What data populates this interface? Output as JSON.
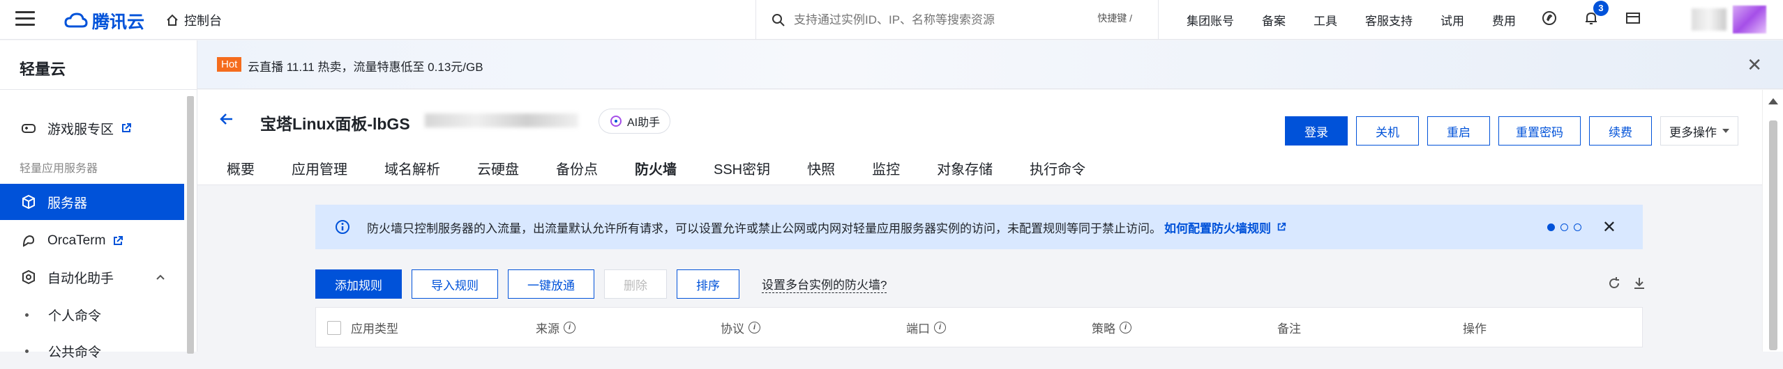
{
  "topbar": {
    "brand": "腾讯云",
    "console": "控制台",
    "search_placeholder": "支持通过实例ID、IP、名称等搜索资源",
    "shortcut": "快捷键 /",
    "links": [
      "集团账号",
      "备案",
      "工具",
      "客服支持",
      "试用",
      "费用"
    ],
    "notification_count": "3"
  },
  "banner": {
    "hot": "Hot",
    "text": "云直播 11.11 热卖，流量特惠低至 0.13元/GB"
  },
  "sidebar": {
    "title": "轻量云",
    "game_zone": "游戏服专区",
    "section": "轻量应用服务器",
    "servers": "服务器",
    "orcaterm": "OrcaTerm",
    "automation": "自动化助手",
    "personal_cmd": "个人命令",
    "public_cmd": "公共命令"
  },
  "instance": {
    "title": "宝塔Linux面板-lbGS",
    "ai": "AI助手"
  },
  "actions": [
    "登录",
    "关机",
    "重启",
    "重置密码",
    "续费"
  ],
  "more_actions": "更多操作",
  "tabs": [
    "概要",
    "应用管理",
    "域名解析",
    "云硬盘",
    "备份点",
    "防火墙",
    "SSH密钥",
    "快照",
    "监控",
    "对象存储",
    "执行命令"
  ],
  "active_tab": "防火墙",
  "info": {
    "text": "防火墙只控制服务器的入流量，出流量默认允许所有请求，可以设置允许或禁止公网或内网对轻量应用服务器实例的访问，未配置规则等同于禁止访问。",
    "link": "如何配置防火墙规则"
  },
  "toolbar": {
    "add": "添加规则",
    "import": "导入规则",
    "allow_all": "一键放通",
    "delete": "删除",
    "sort": "排序",
    "multi": "设置多台实例的防火墙?"
  },
  "table": {
    "headers": [
      "应用类型",
      "来源",
      "协议",
      "端口",
      "策略",
      "备注",
      "操作"
    ]
  },
  "colors": {
    "primary": "#0052d9",
    "hot": "#f56c1d",
    "info_bg": "#d9e8ff"
  }
}
